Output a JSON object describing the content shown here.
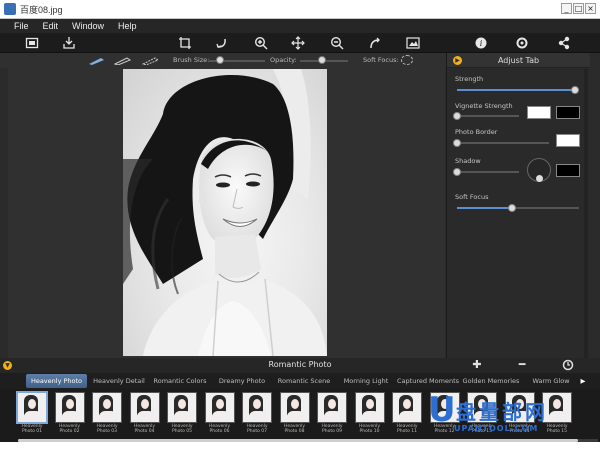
{
  "window": {
    "title": "百度08.jpg",
    "buttons": [
      "_",
      "□",
      "×"
    ]
  },
  "menu": [
    "File",
    "Edit",
    "Window",
    "Help"
  ],
  "toolbar_icons": [
    "fit-screen-icon",
    "save-icon",
    "crop-icon",
    "undo-icon",
    "zoom-in-icon",
    "pan-icon",
    "zoom-out-icon",
    "redo-icon",
    "compare-icon",
    "info-icon",
    "settings-icon",
    "share-icon"
  ],
  "brushbar": {
    "brush_size_label": "Brush Size:",
    "opacity_label": "Opacity:",
    "soft_focus_label": "Soft Focus:",
    "brush_size": 0.2,
    "opacity": 0.45
  },
  "adjust": {
    "title": "Adjust Tab",
    "strength_label": "Strength",
    "strength": 0.97,
    "vignette_label": "Vignette Strength",
    "vignette": 0.0,
    "vignette_colors": [
      "#ffffff",
      "#000000"
    ],
    "border_label": "Photo Border",
    "border": 0.0,
    "border_color": "#ffffff",
    "shadow_label": "Shadow",
    "shadow": 0.0,
    "shadow_color": "#000000",
    "soft_focus_label": "Soft Focus",
    "soft_focus": 0.45
  },
  "category": {
    "title": "Romantic Photo",
    "tabs": [
      "Heavenly Photo",
      "Heavenly Detail",
      "Romantic Colors",
      "Dreamy Photo",
      "Romantic Scene",
      "Morning Light",
      "Captured Moments",
      "Golden Memories",
      "Warm Glow"
    ],
    "active_tab": "Heavenly Photo"
  },
  "thumbnails": [
    {
      "top": "Heavenly",
      "bottom": "Photo 01"
    },
    {
      "top": "Heavenly",
      "bottom": "Photo 02"
    },
    {
      "top": "Heavenly",
      "bottom": "Photo 03"
    },
    {
      "top": "Heavenly",
      "bottom": "Photo 04"
    },
    {
      "top": "Heavenly",
      "bottom": "Photo 05"
    },
    {
      "top": "Heavenly",
      "bottom": "Photo 06"
    },
    {
      "top": "Heavenly",
      "bottom": "Photo 07"
    },
    {
      "top": "Heavenly",
      "bottom": "Photo 08"
    },
    {
      "top": "Heavenly",
      "bottom": "Photo 09"
    },
    {
      "top": "Heavenly",
      "bottom": "Photo 10"
    },
    {
      "top": "Heavenly",
      "bottom": "Photo 11"
    },
    {
      "top": "Heavenly",
      "bottom": "Photo 12"
    },
    {
      "top": "Heavenly",
      "bottom": "Photo 13"
    },
    {
      "top": "Heavenly",
      "bottom": "Photo 14"
    },
    {
      "top": "Heavenly",
      "bottom": "Photo 15"
    }
  ],
  "watermark": {
    "letter": "U",
    "text": "盘量部网",
    "url": "UPANTOOL.COM"
  }
}
